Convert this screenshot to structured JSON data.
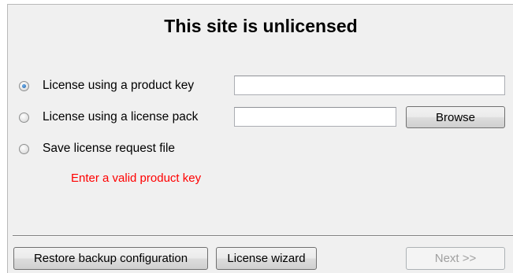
{
  "dialog": {
    "title": "This site is unlicensed"
  },
  "options": [
    {
      "label": "License using a product key",
      "checked": true
    },
    {
      "label": "License using a license pack",
      "checked": false
    },
    {
      "label": "Save license request file",
      "checked": false
    }
  ],
  "product_key_input": {
    "value": ""
  },
  "license_pack_input": {
    "value": ""
  },
  "buttons": {
    "browse": "Browse",
    "restore_backup": "Restore backup configuration",
    "license_wizard": "License wizard",
    "next": "Next >>"
  },
  "validation": {
    "message": "Enter a valid product key"
  },
  "colors": {
    "error": "#ff0000",
    "background": "#f0f0f0"
  }
}
